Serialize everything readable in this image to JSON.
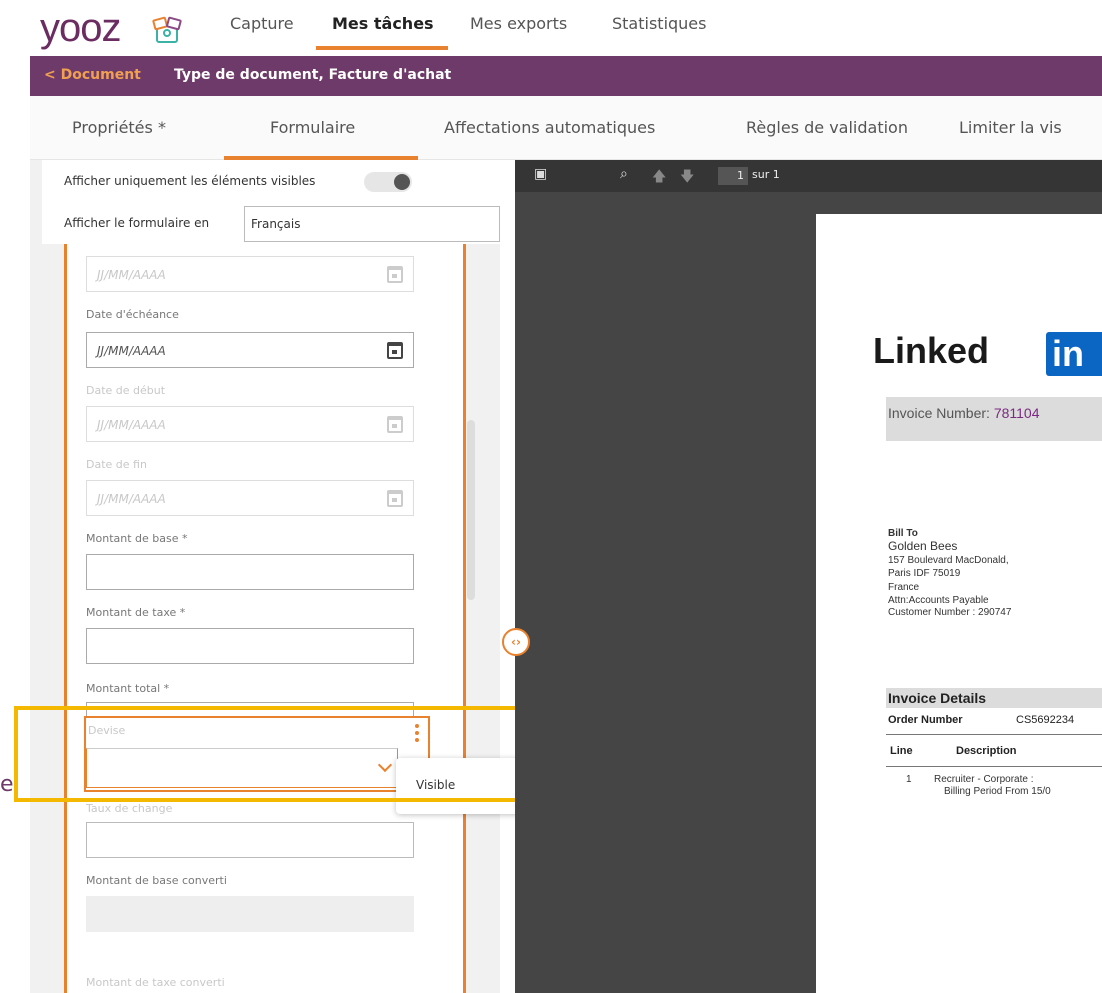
{
  "logo": {
    "text": "yooz"
  },
  "nav": {
    "items": [
      {
        "label": "Capture"
      },
      {
        "label": "Mes tâches"
      },
      {
        "label": "Mes exports"
      },
      {
        "label": "Statistiques"
      }
    ],
    "active": "Mes tâches"
  },
  "breadcrumb": {
    "back_label": "< Document",
    "title": "Type de document, Facture d'achat"
  },
  "tabs": [
    {
      "label": "Propriétés *"
    },
    {
      "label": "Formulaire"
    },
    {
      "label": "Affectations automatiques"
    },
    {
      "label": "Règles de validation"
    },
    {
      "label": "Limiter la vis"
    }
  ],
  "options": {
    "visible_only_label": "Afficher uniquement les éléments visibles",
    "form_language_label": "Afficher le formulaire en",
    "form_language_value": "Français"
  },
  "form": {
    "date_placeholder": "JJ/MM/AAAA",
    "fields": {
      "echeance": "Date d'échéance",
      "debut": "Date de début",
      "fin": "Date de fin",
      "montant_base": "Montant de base *",
      "montant_taxe": "Montant de taxe *",
      "montant_total": "Montant total *",
      "devise": "Devise",
      "taux_change": "Taux de change",
      "base_converti": "Montant de base converti",
      "taxe_converti": "Montant de taxe converti"
    }
  },
  "popover": {
    "label": "Visible"
  },
  "side_char": "e",
  "viewer": {
    "page_current": "1",
    "page_of": "sur 1",
    "handle_glyph": "‹›"
  },
  "invoice": {
    "logo_word": "Linked",
    "logo_in": "in",
    "number_label": "Invoice Number:",
    "number_value": "781104",
    "bill_to": "Bill To",
    "company": "Golden Bees",
    "address1": "157 Boulevard MacDonald,",
    "address2": "Paris  IDF 75019",
    "country": "France",
    "attn": "Attn:Accounts Payable",
    "customer": "Customer Number : 290747",
    "details_title": "Invoice Details",
    "order_label": "Order Number",
    "order_value": "CS5692234",
    "col_line": "Line",
    "col_desc": "Description",
    "row1_line": "1",
    "row1_desc": "Recruiter - Corporate   :",
    "row1_desc2": "Billing Period From 15/0"
  },
  "colors": {
    "brand": "#6e3a69",
    "accent": "#e8822e",
    "highlight": "#f5b800",
    "linkedin": "#0a66c2"
  }
}
